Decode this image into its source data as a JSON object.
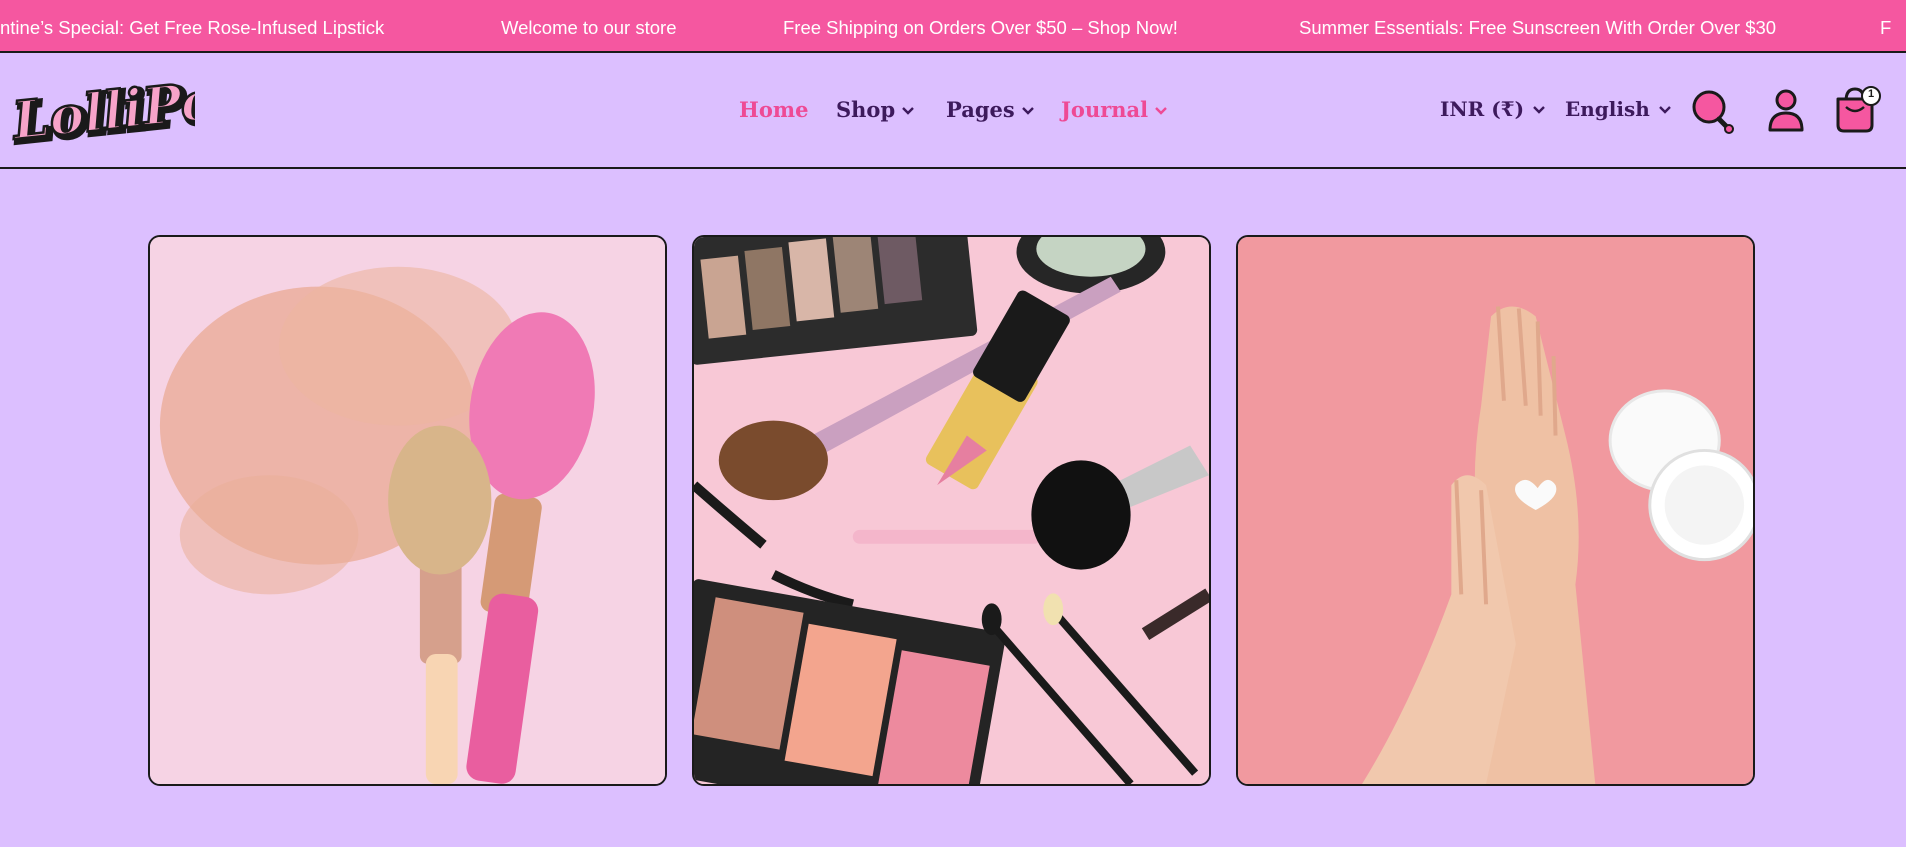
{
  "announcements": [
    "ntine’s Special: Get Free Rose-Infused Lipstick",
    "Welcome to our store",
    "Free Shipping on Orders Over $50 – Shop Now!",
    "Summer Essentials: Free Sunscreen With Order Over $30",
    "F"
  ],
  "brand": {
    "logo_text": "LolliPop"
  },
  "nav": {
    "home": "Home",
    "shop": "Shop",
    "pages": "Pages",
    "journal": "Journal"
  },
  "currency": {
    "selected": "INR (₹)"
  },
  "language": {
    "selected": "English"
  },
  "cart": {
    "count": "1"
  },
  "colors": {
    "announcement_bg": "#f557a0",
    "page_bg": "#dcbfff",
    "nav_text": "#3d1a5c",
    "accent_pink": "#ee4a95"
  },
  "icons": [
    "chevron-down-icon",
    "search-icon",
    "account-icon",
    "cart-icon"
  ],
  "gallery": {
    "images": [
      {
        "name": "blush-powder-brushes"
      },
      {
        "name": "makeup-flatlay"
      },
      {
        "name": "hands-cream-jar"
      }
    ]
  }
}
